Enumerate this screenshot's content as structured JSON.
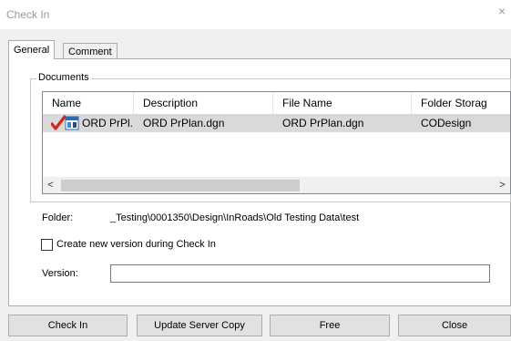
{
  "window": {
    "title": "Check In",
    "close_glyph": "×"
  },
  "tabs": [
    {
      "label": "General",
      "active": true
    },
    {
      "label": "Comment",
      "active": false
    }
  ],
  "documents": {
    "group_label": "Documents",
    "columns": [
      "Name",
      "Description",
      "File Name",
      "Folder Storag"
    ],
    "rows": [
      {
        "name": "ORD PrPl...",
        "description": "ORD PrPlan.dgn",
        "file_name": "ORD PrPlan.dgn",
        "folder_storage": "CODesign",
        "icons": [
          "checkmark-icon",
          "microstation-document-icon"
        ]
      }
    ],
    "scroll_left_glyph": "<",
    "scroll_right_glyph": ">"
  },
  "folder": {
    "label": "Folder:",
    "value": "_Testing\\0001350\\Design\\InRoads\\Old Testing Data\\test"
  },
  "create_version": {
    "label": "Create new version during Check In",
    "checked": false
  },
  "version": {
    "label": "Version:",
    "value": ""
  },
  "buttons": {
    "check_in": "Check In",
    "update_server_copy": "Update Server Copy",
    "free": "Free",
    "close": "Close"
  },
  "colors": {
    "checkmark": "#d0281e",
    "selection": "#d9d9d9",
    "button_face": "#e1e1e1"
  }
}
